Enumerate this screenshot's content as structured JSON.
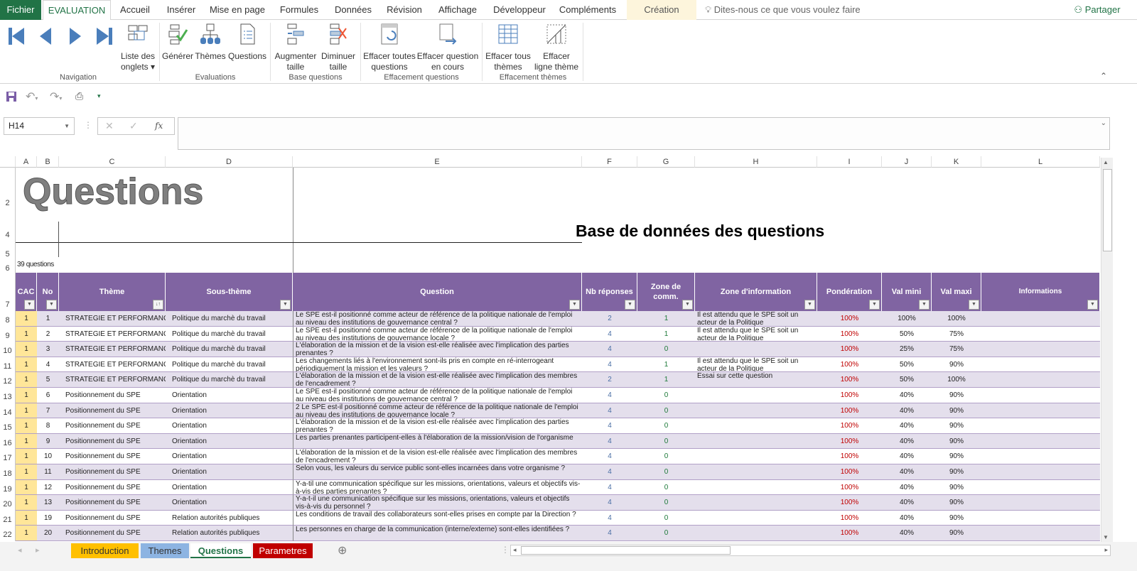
{
  "ribbon_tabs": [
    "Fichier",
    "EVALUATION",
    "Accueil",
    "Insérer",
    "Mise en page",
    "Formules",
    "Données",
    "Révision",
    "Affichage",
    "Développeur",
    "Compléments",
    "Création"
  ],
  "tell_me": "Dites-nous ce que vous voulez faire",
  "share": "Partager",
  "groups": {
    "navigation": {
      "label": "Navigation",
      "list_label1": "Liste des",
      "list_label2": "onglets"
    },
    "evaluations": {
      "label": "Evaluations",
      "buttons": [
        "Générer",
        "Thèmes",
        "Questions"
      ]
    },
    "base": {
      "label": "Base questions",
      "b1a": "Augmenter",
      "b1b": "taille",
      "b2a": "Diminuer",
      "b2b": "taille"
    },
    "effq": {
      "label": "Effacement questions",
      "b1a": "Effacer toutes",
      "b1b": "questions",
      "b2a": "Effacer question",
      "b2b": "en cours"
    },
    "efft": {
      "label": "Effacement thèmes",
      "b1a": "Effacer tous",
      "b1b": "thèmes",
      "b2a": "Effacer",
      "b2b": "ligne thème"
    }
  },
  "name_box": "H14",
  "formula_fx": "fx",
  "columns": [
    "A",
    "B",
    "C",
    "D",
    "E",
    "F",
    "G",
    "H",
    "I",
    "J",
    "K",
    "L"
  ],
  "row_numbers_top": [
    "2",
    "4",
    "5",
    "6",
    "7"
  ],
  "sheet": {
    "title": "Questions",
    "subtitle": "Base de données des questions",
    "count": "39 questions"
  },
  "headers": [
    "CAC",
    "No",
    "Thème",
    "Sous-thème",
    "Question",
    "Nb réponses",
    "Zone de comm.",
    "Zone d'information",
    "Pondération",
    "Val mini",
    "Val maxi",
    "Informations"
  ],
  "rows": [
    {
      "r": "8",
      "cac": "1",
      "no": "1",
      "theme": "STRATEGIE ET PERFORMANC",
      "sub": "Politique du marchè du travail",
      "q": "Le SPE est-il positionné comme acteur de référence de la politique nationale de l'emploi au niveau des institutions de gouvernance central ?",
      "nb": "2",
      "zc": "1",
      "info": "Il est attendu que le SPE soit un acteur de la Politique",
      "pond": "100%",
      "min": "100%",
      "max": "100%"
    },
    {
      "r": "9",
      "cac": "1",
      "no": "2",
      "theme": "STRATEGIE ET PERFORMANC",
      "sub": "Politique du marchè du travail",
      "q": "Le SPE est-il positionné comme acteur de référence de la politique nationale de l'emploi au niveau des institutions de gouvernance locale ?",
      "nb": "4",
      "zc": "1",
      "info": "Il est attendu que le SPE soit un acteur de la Politique",
      "pond": "100%",
      "min": "50%",
      "max": "75%"
    },
    {
      "r": "10",
      "cac": "1",
      "no": "3",
      "theme": "STRATEGIE ET PERFORMANC",
      "sub": "Politique du marchè du travail",
      "q": "L'élaboration de la mission et de la vision est-elle réalisée avec l'implication des parties prenantes ?",
      "nb": "4",
      "zc": "0",
      "info": "",
      "pond": "100%",
      "min": "25%",
      "max": "75%"
    },
    {
      "r": "11",
      "cac": "1",
      "no": "4",
      "theme": "STRATEGIE ET PERFORMANC",
      "sub": "Politique du marchè du travail",
      "q": "Les changements liés à l'environnement sont-ils pris en compte en ré-interrogeant périodiquement la mission et les valeurs ?",
      "nb": "4",
      "zc": "1",
      "info": "Il est attendu que le SPE soit un acteur de la Politique",
      "pond": "100%",
      "min": "50%",
      "max": "90%"
    },
    {
      "r": "12",
      "cac": "1",
      "no": "5",
      "theme": "STRATEGIE ET PERFORMANC",
      "sub": "Politique du marchè du travail",
      "q": "L'élaboration de la mission et de la vision est-elle réalisée avec l'implication des membres de l'encadrement ?",
      "nb": "2",
      "zc": "1",
      "info": "Essai sur cette question",
      "pond": "100%",
      "min": "50%",
      "max": "100%"
    },
    {
      "r": "13",
      "cac": "1",
      "no": "6",
      "theme": "Positionnement du SPE",
      "sub": "Orientation",
      "q": "Le SPE est-il positionné comme acteur de référence de la politique nationale de l'emploi au niveau des institutions de gouvernance central ?",
      "nb": "4",
      "zc": "0",
      "info": "",
      "pond": "100%",
      "min": "40%",
      "max": "90%"
    },
    {
      "r": "14",
      "cac": "1",
      "no": "7",
      "theme": "Positionnement du SPE",
      "sub": "Orientation",
      "q": "2 Le SPE est-il positionné comme acteur de référence de la politique nationale de l'emploi au niveau des institutions de gouvernance locale ?",
      "nb": "4",
      "zc": "0",
      "info": "",
      "pond": "100%",
      "min": "40%",
      "max": "90%"
    },
    {
      "r": "15",
      "cac": "1",
      "no": "8",
      "theme": "Positionnement du SPE",
      "sub": "Orientation",
      "q": "L'élaboration de la mission et de la vision est-elle réalisée avec l'implication des parties prenantes ?",
      "nb": "4",
      "zc": "0",
      "info": "",
      "pond": "100%",
      "min": "40%",
      "max": "90%"
    },
    {
      "r": "16",
      "cac": "1",
      "no": "9",
      "theme": "Positionnement du SPE",
      "sub": "Orientation",
      "q": "Les parties prenantes participent-elles à l'élaboration de la mission/vision de l'organisme",
      "nb": "4",
      "zc": "0",
      "info": "",
      "pond": "100%",
      "min": "40%",
      "max": "90%"
    },
    {
      "r": "17",
      "cac": "1",
      "no": "10",
      "theme": "Positionnement du SPE",
      "sub": "Orientation",
      "q": "L'élaboration de la mission et de la vision est-elle réalisée avec l'implication des membres de l'encadrement ?",
      "nb": "4",
      "zc": "0",
      "info": "",
      "pond": "100%",
      "min": "40%",
      "max": "90%"
    },
    {
      "r": "18",
      "cac": "1",
      "no": "11",
      "theme": "Positionnement du SPE",
      "sub": "Orientation",
      "q": "Selon vous, les valeurs du service public sont-elles incarnées dans votre organisme ?",
      "nb": "4",
      "zc": "0",
      "info": "",
      "pond": "100%",
      "min": "40%",
      "max": "90%"
    },
    {
      "r": "19",
      "cac": "1",
      "no": "12",
      "theme": "Positionnement du SPE",
      "sub": "Orientation",
      "q": "Y-a-til une communication spécifique sur les missions, orientations, valeurs et objectifs vis-à-vis des parties prenantes ?",
      "nb": "4",
      "zc": "0",
      "info": "",
      "pond": "100%",
      "min": "40%",
      "max": "90%"
    },
    {
      "r": "20",
      "cac": "1",
      "no": "13",
      "theme": "Positionnement du SPE",
      "sub": "Orientation",
      "q": "Y-a-t-il une communication spécifique sur les missions, orientations, valeurs et objectifs vis-à-vis du personnel ?",
      "nb": "4",
      "zc": "0",
      "info": "",
      "pond": "100%",
      "min": "40%",
      "max": "90%"
    },
    {
      "r": "21",
      "cac": "1",
      "no": "19",
      "theme": "Positionnement du SPE",
      "sub": "Relation autorités publiques",
      "q": "Les conditions de travail des collaborateurs sont-elles prises en compte par la Direction ?",
      "nb": "4",
      "zc": "0",
      "info": "",
      "pond": "100%",
      "min": "40%",
      "max": "90%"
    },
    {
      "r": "22",
      "cac": "1",
      "no": "20",
      "theme": "Positionnement du SPE",
      "sub": "Relation autorités publiques",
      "q": "Les personnes en charge de la communication (interne/externe) sont-elles identifiées ?",
      "nb": "4",
      "zc": "0",
      "info": "",
      "pond": "100%",
      "min": "40%",
      "max": "90%"
    }
  ],
  "sheet_tabs": [
    {
      "label": "Introduction",
      "bg": "#ffc000",
      "fg": "#333"
    },
    {
      "label": "Themes",
      "bg": "#8db4e2",
      "fg": "#333"
    },
    {
      "label": "Questions",
      "bg": "#fff",
      "fg": "#217346"
    },
    {
      "label": "Parametres",
      "bg": "#c00000",
      "fg": "#fff"
    }
  ],
  "colors": {
    "header": "#8064a2",
    "stripe": "#e4dfec",
    "cac": "#ffe699",
    "excel_green": "#217346"
  }
}
